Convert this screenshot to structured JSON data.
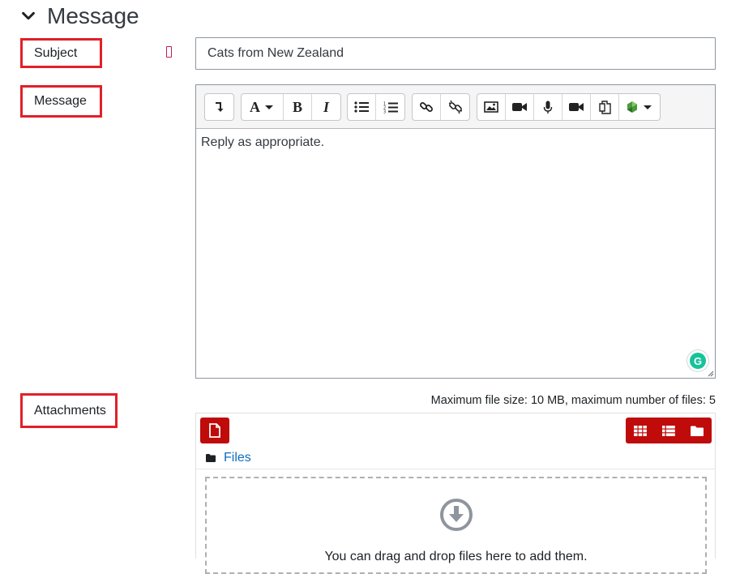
{
  "section": {
    "title": "Message",
    "icon": "chevron-down-icon"
  },
  "subject": {
    "label": "Subject",
    "value": "Cats from New Zealand",
    "required": true
  },
  "message": {
    "label": "Message",
    "content": "Reply as appropriate.",
    "toolbar": {
      "groups": [
        [
          "collapse-toggle"
        ],
        [
          "font-style-dropdown",
          "bold",
          "italic"
        ],
        [
          "unordered-list",
          "ordered-list"
        ],
        [
          "link",
          "unlink"
        ],
        [
          "image",
          "video",
          "record-audio",
          "record-video",
          "manage-files",
          "h5p-dropdown"
        ]
      ]
    }
  },
  "attachments": {
    "label": "Attachments",
    "max_info": "Maximum file size: 10 MB, maximum number of files: 5",
    "path_label": "Files",
    "drop_text": "You can drag and drop files here to add them."
  },
  "colors": {
    "accent_red": "#c00b0b",
    "label_border": "#e0202a",
    "link": "#0f6cbf"
  }
}
